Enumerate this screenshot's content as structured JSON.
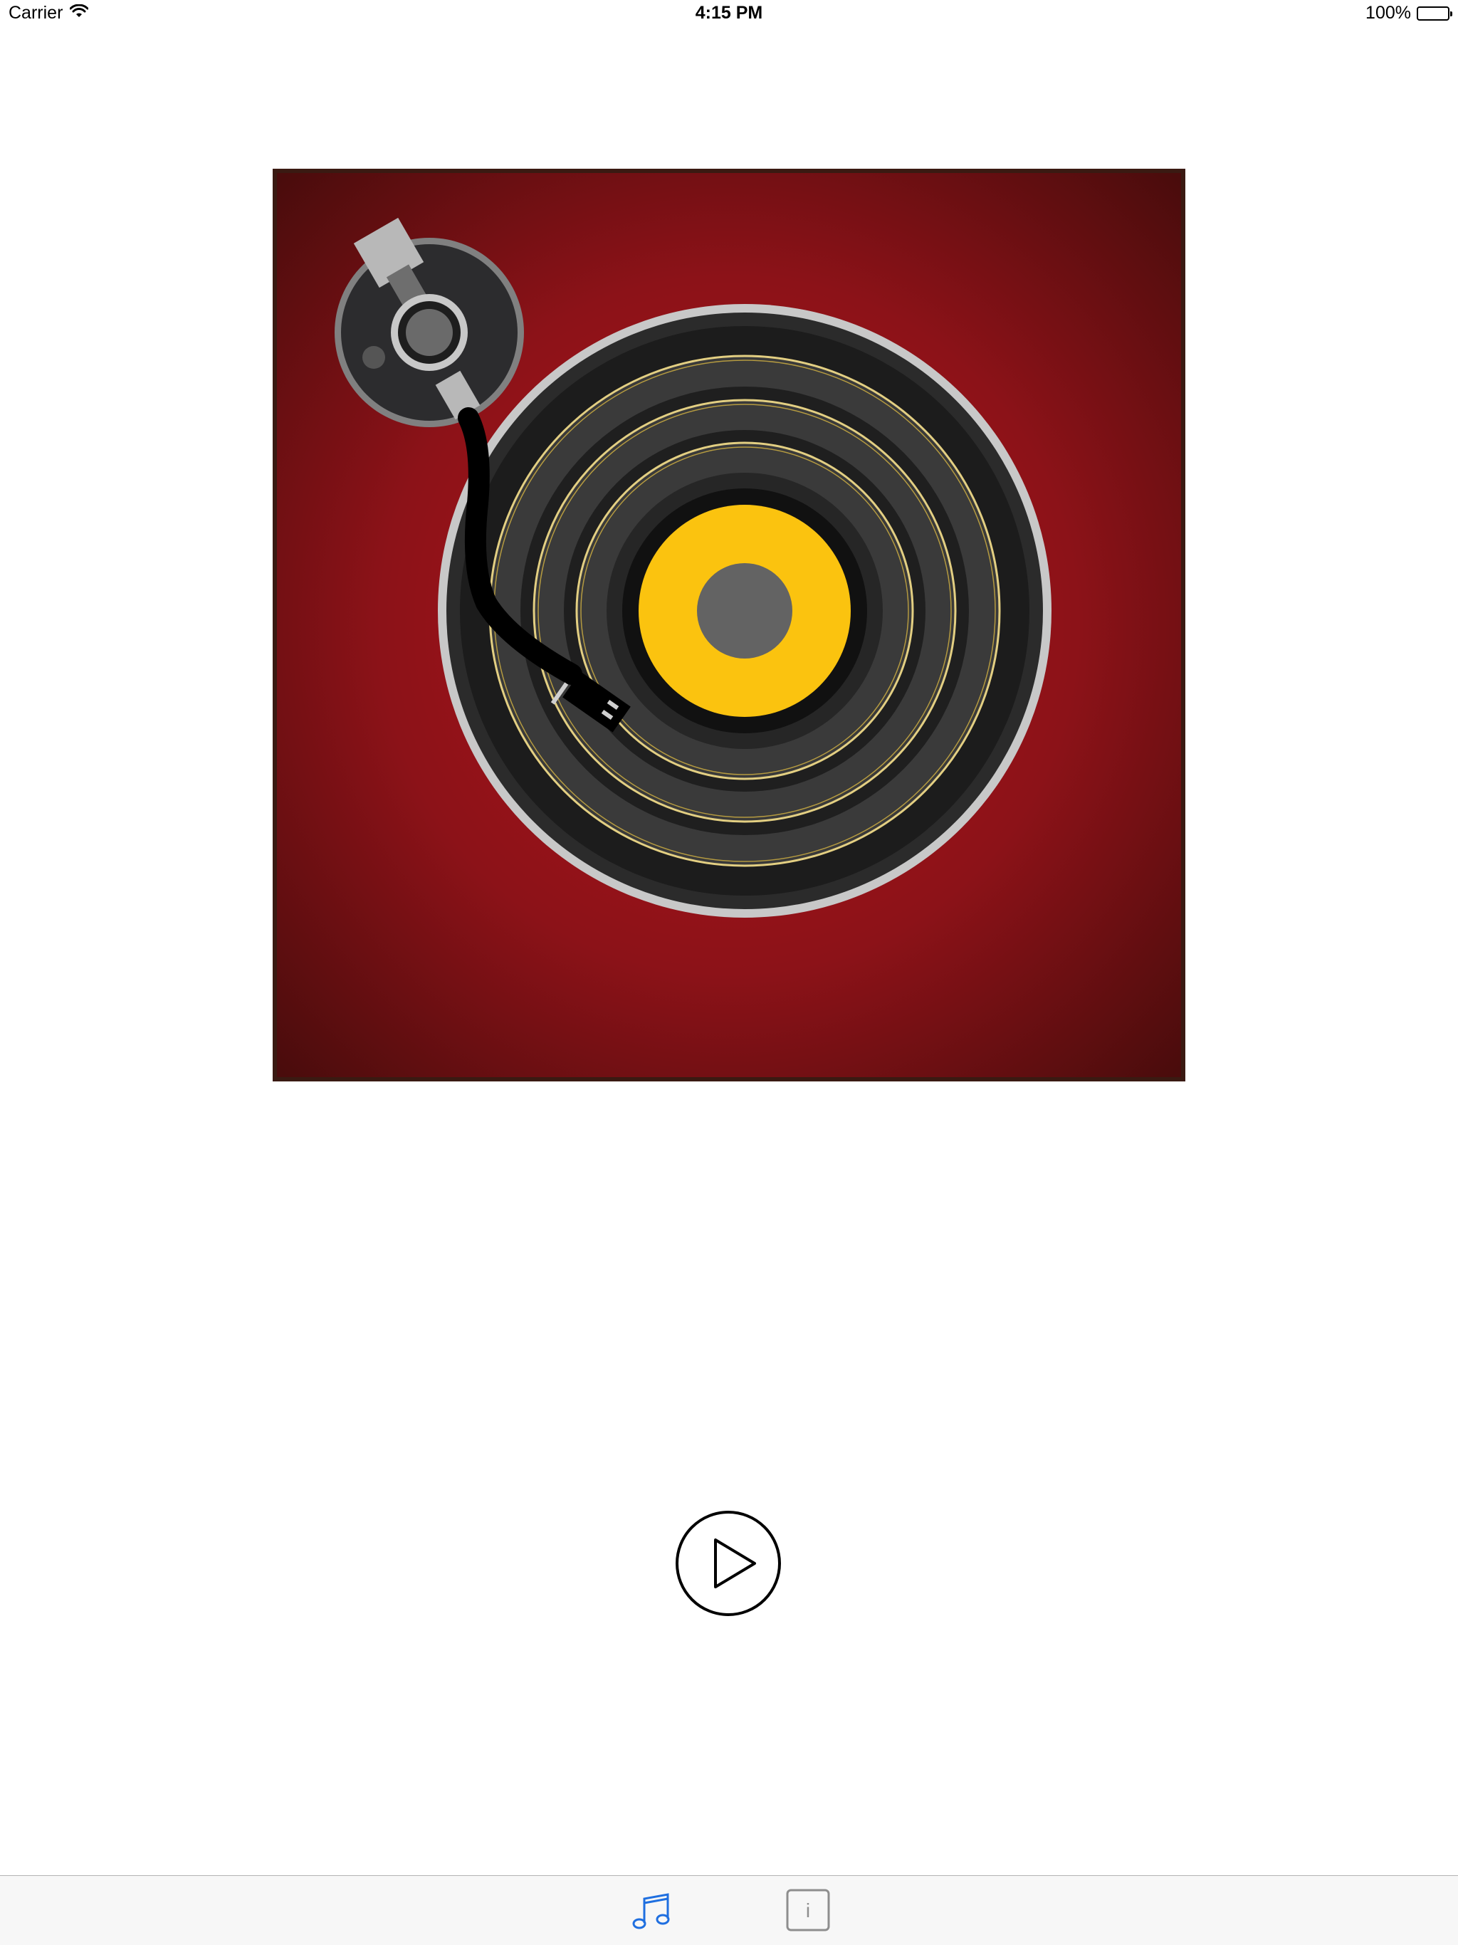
{
  "status_bar": {
    "carrier": "Carrier",
    "time": "4:15 PM",
    "battery_percent": "100%",
    "battery_level": 1.0
  },
  "icons": {
    "wifi": "wifi-icon",
    "battery": "battery-icon",
    "turntable": "turntable-artwork",
    "play": "play-circle-icon",
    "music_tab": "music-notes-icon",
    "info_tab": "info-icon"
  },
  "tab_bar": {
    "selected": "music",
    "info_glyph": "i"
  },
  "colors": {
    "accent": "#1f6fe0",
    "label_yellow": "#fbc30f",
    "background_red": "#8b1218",
    "spindle_gray": "#636363"
  }
}
